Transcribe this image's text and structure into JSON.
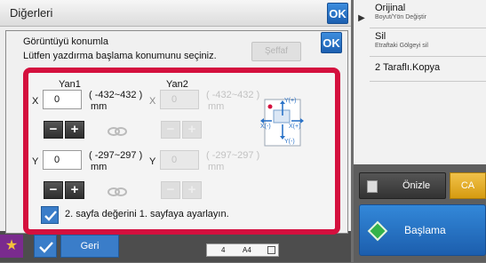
{
  "background": {
    "title": "Diğerleri",
    "ok_label": "OK"
  },
  "right_menu": {
    "items": [
      {
        "title": "Orijinal",
        "subtitle": "Boyut/Yön Değiştir"
      },
      {
        "title": "Sil",
        "subtitle": "Etraftaki Gölgeyi sil"
      },
      {
        "title": "2 Taraflı.Kopya",
        "subtitle": ""
      }
    ],
    "preview_label": "Önizle",
    "ca_label": "CA",
    "start_label": "Başlama"
  },
  "bottom_bar": {
    "back_label": "Geri",
    "paper_count": "4",
    "paper_size": "A4"
  },
  "dialog": {
    "ok_label": "OK",
    "title": "Görüntüyü konumla",
    "description": "Lütfen yazdırma başlama konumunu seçiniz.",
    "transparent_label": "Şeffaf",
    "side1_label": "Yan1",
    "side2_label": "Yan2",
    "x_label": "X",
    "y_label": "Y",
    "x_side1_value": "0",
    "x_side2_value": "0",
    "x_range_line1": "( -432~432 )",
    "x_range_line2": "mm",
    "y_side1_value": "0",
    "y_side2_value": "0",
    "y_range_line1": "( -297~297 )",
    "y_range_line2": "mm",
    "minus_label": "−",
    "plus_label": "+",
    "same_value_label": "2. sayfa değerini 1. sayfaya ayarlayın.",
    "diagram": {
      "y_plus": "Y(+)",
      "y_minus": "Y(-)",
      "x_plus": "X(+)",
      "x_minus": "X(-)"
    }
  },
  "colors": {
    "accent_blue": "#2b73c8",
    "highlight_red": "#d4103e",
    "start_green": "#33b34a",
    "ca_yellow": "#e6b022"
  }
}
